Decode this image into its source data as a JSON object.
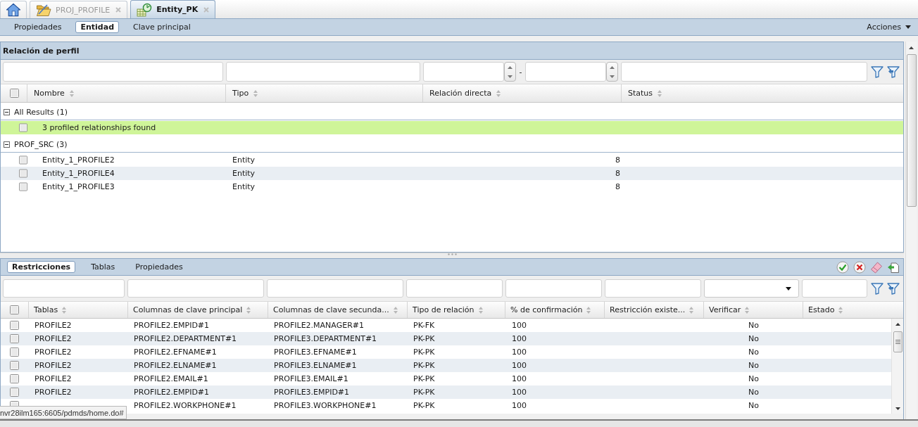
{
  "tabs": [
    {
      "kind": "home",
      "selected": false
    },
    {
      "kind": "folder",
      "label": "PROJ_PROFILE",
      "selected": false
    },
    {
      "kind": "entity",
      "label": "Entity_PK",
      "selected": true
    }
  ],
  "toolbar": {
    "items": [
      {
        "label": "Propiedades",
        "selected": false
      },
      {
        "label": "Entidad",
        "selected": true
      },
      {
        "label": "Clave principal",
        "selected": false
      }
    ],
    "actions": "Acciones"
  },
  "profile_panel": {
    "title": "Relación de perfil",
    "filters": [
      {
        "kind": "text"
      },
      {
        "kind": "text"
      },
      {
        "kind": "number"
      },
      {
        "kind": "separator",
        "label": "-"
      },
      {
        "kind": "number"
      },
      {
        "kind": "text"
      }
    ],
    "all_checked": false,
    "columns": [
      "Nombre",
      "Tipo",
      "Relación directa",
      "Status"
    ],
    "groups": [
      {
        "label": "All Results (1)",
        "expanded": true,
        "rows": [
          {
            "kind": "summary",
            "checked": false,
            "label": "3 profiled relationships found"
          }
        ]
      },
      {
        "label": "PROF_SRC (3)",
        "expanded": true,
        "rows": [
          {
            "kind": "item",
            "checked": false,
            "nombre": "Entity_1_PROFILE2",
            "tipo": "Entity",
            "relacion_directa": "8"
          },
          {
            "kind": "item",
            "checked": false,
            "nombre": "Entity_1_PROFILE4",
            "tipo": "Entity",
            "relacion_directa": "8"
          },
          {
            "kind": "item",
            "checked": false,
            "nombre": "Entity_1_PROFILE3",
            "tipo": "Entity",
            "relacion_directa": "8"
          }
        ]
      }
    ]
  },
  "constraints_panel": {
    "tabs": [
      {
        "label": "Restricciones",
        "selected": true
      },
      {
        "label": "Tablas",
        "selected": false
      },
      {
        "label": "Propiedades",
        "selected": false
      }
    ],
    "filters": [
      {
        "kind": "text"
      },
      {
        "kind": "text"
      },
      {
        "kind": "text"
      },
      {
        "kind": "text"
      },
      {
        "kind": "text"
      },
      {
        "kind": "text"
      },
      {
        "kind": "select"
      },
      {
        "kind": "text"
      }
    ],
    "all_checked": false,
    "columns": [
      "Tablas",
      "Columnas de clave principal",
      "Columnas de clave secunda...",
      "Tipo de relación",
      "% de confirmación",
      "Restricción existe...",
      "Verificar",
      "Estado"
    ],
    "rows": [
      {
        "checked": false,
        "tablas": "PROFILE2",
        "clave_principal": "PROFILE2.EMPID#1",
        "clave_secundaria": "PROFILE2.MANAGER#1",
        "tipo_relacion": "PK-FK",
        "confirmacion": "100",
        "verificar": "No"
      },
      {
        "checked": false,
        "tablas": "PROFILE2",
        "clave_principal": "PROFILE2.DEPARTMENT#1",
        "clave_secundaria": "PROFILE3.DEPARTMENT#1",
        "tipo_relacion": "PK-PK",
        "confirmacion": "100",
        "verificar": "No"
      },
      {
        "checked": false,
        "tablas": "PROFILE2",
        "clave_principal": "PROFILE2.EFNAME#1",
        "clave_secundaria": "PROFILE3.EFNAME#1",
        "tipo_relacion": "PK-PK",
        "confirmacion": "100",
        "verificar": "No"
      },
      {
        "checked": false,
        "tablas": "PROFILE2",
        "clave_principal": "PROFILE2.ELNAME#1",
        "clave_secundaria": "PROFILE3.ELNAME#1",
        "tipo_relacion": "PK-PK",
        "confirmacion": "100",
        "verificar": "No"
      },
      {
        "checked": false,
        "tablas": "PROFILE2",
        "clave_principal": "PROFILE2.EMAIL#1",
        "clave_secundaria": "PROFILE3.EMAIL#1",
        "tipo_relacion": "PK-PK",
        "confirmacion": "100",
        "verificar": "No"
      },
      {
        "checked": false,
        "tablas": "PROFILE2",
        "clave_principal": "PROFILE2.EMPID#1",
        "clave_secundaria": "PROFILE3.EMPID#1",
        "tipo_relacion": "PK-PK",
        "confirmacion": "100",
        "verificar": "No"
      },
      {
        "checked": false,
        "clave_principal": "PROFILE2.WORKPHONE#1",
        "clave_secundaria": "PROFILE3.WORKPHONE#1",
        "tipo_relacion": "PK-PK",
        "confirmacion": "100",
        "verificar": "No"
      }
    ]
  },
  "status_link": "nvr28ilm165:6605/pdmds/home.do#"
}
